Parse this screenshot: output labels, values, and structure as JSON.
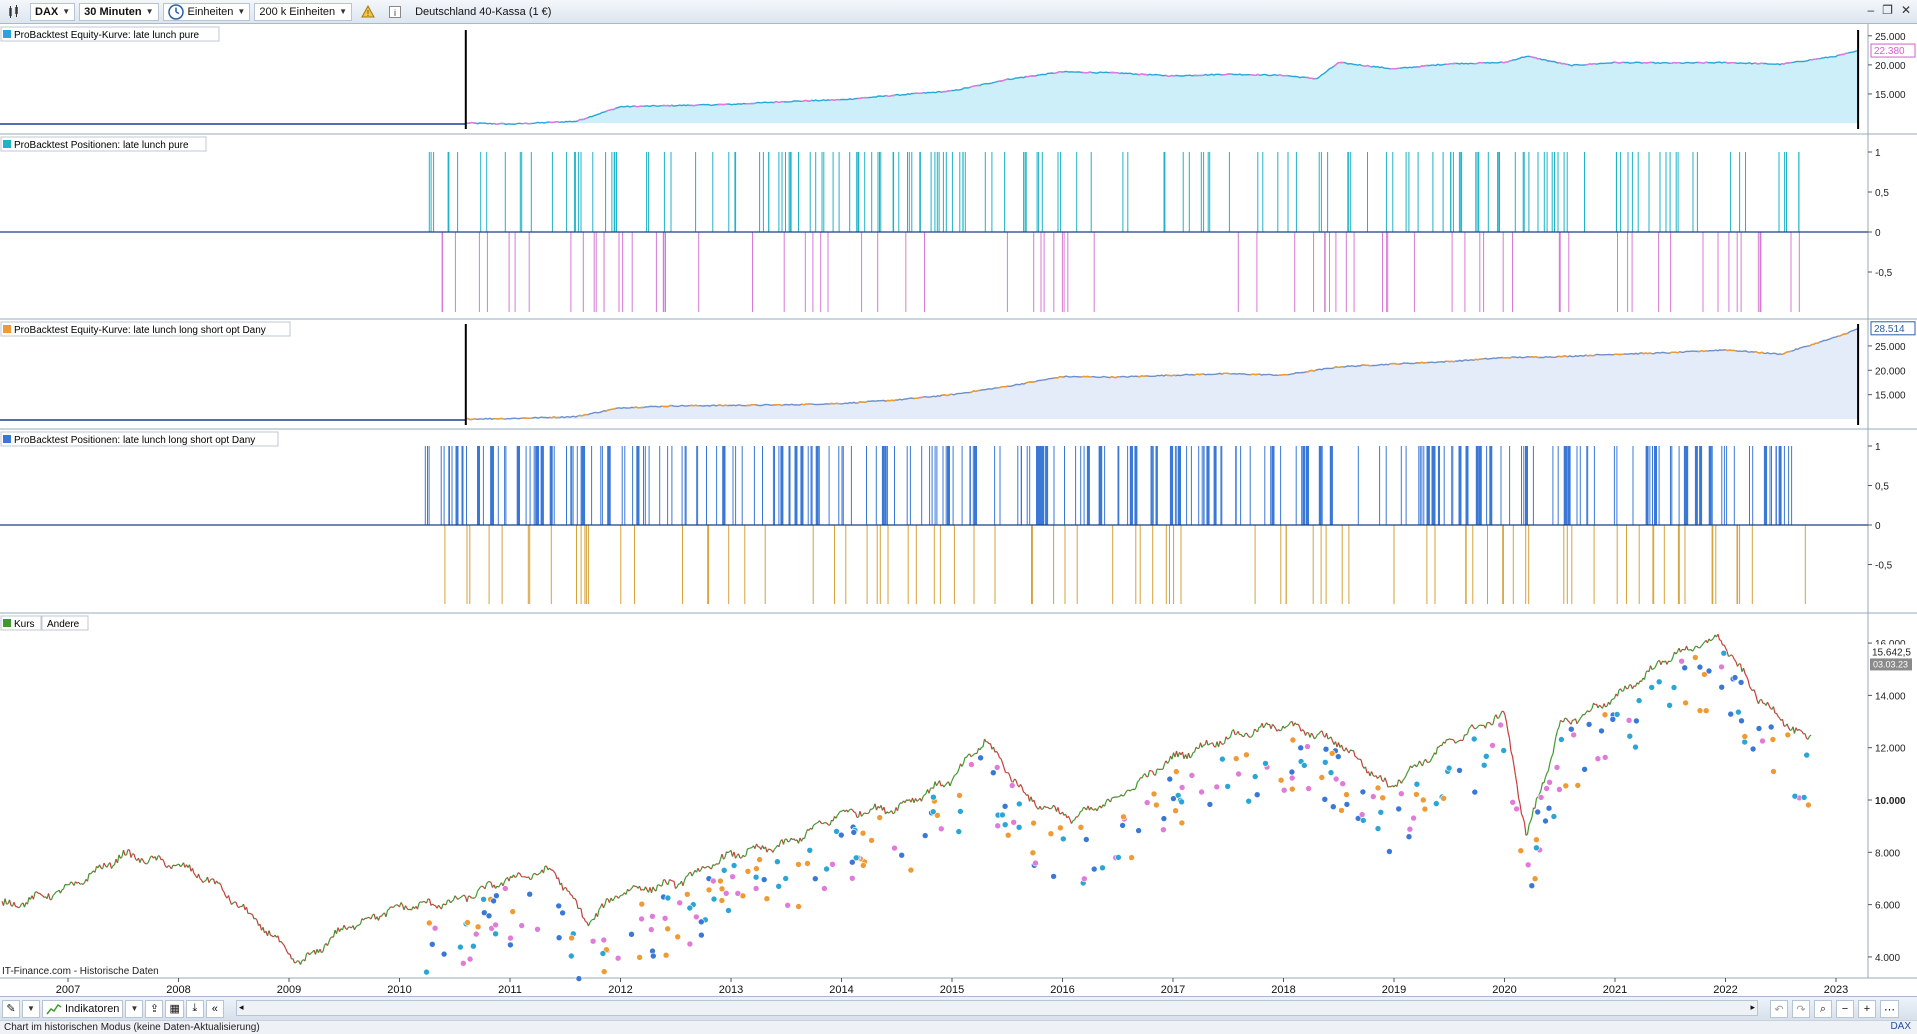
{
  "toolbar": {
    "instrument": "DAX",
    "timeframe": "30 Minuten",
    "units_mode": "Einheiten",
    "units_count": "200 k Einheiten",
    "instrument_name": "Deutschland 40-Kassa (1 €)",
    "warning_icon": "warning-icon",
    "info_icon": "info-icon"
  },
  "panels": {
    "equity1_title": "ProBacktest Equity-Kurve: late lunch pure",
    "positions1_title": "ProBacktest Positionen: late lunch pure",
    "equity2_title": "ProBacktest Equity-Kurve: late lunch long short opt Dany",
    "positions2_title": "ProBacktest Positionen: late lunch long short opt Dany",
    "price_tab1": "Kurs",
    "price_tab2": "Andere",
    "source_text": "IT-Finance.com - Historische Daten"
  },
  "axis_labels": {
    "eq1_ticks": [
      "25.000",
      "20.000",
      "15.000"
    ],
    "eq1_current": "22.380",
    "pos_ticks": [
      "1",
      "0,5",
      "0",
      "-0,5"
    ],
    "eq2_ticks": [
      "25.000",
      "20.000",
      "15.000"
    ],
    "eq2_current": "28.514",
    "price_ticks": [
      "16.000",
      "14.000",
      "12.000",
      "10.000",
      "8.000",
      "6.000",
      "4.000"
    ],
    "price_current": "15.642,5",
    "price_date": "03.03.23",
    "years": [
      "2007",
      "2008",
      "2009",
      "2010",
      "2011",
      "2012",
      "2013",
      "2014",
      "2015",
      "2016",
      "2017",
      "2018",
      "2019",
      "2020",
      "2021",
      "2022",
      "2023"
    ]
  },
  "bottombar": {
    "indicators_label": "Indikatoren"
  },
  "status": {
    "text": "Chart im historischen Modus (keine Daten-Aktualisierung)",
    "right_label": "DAX"
  },
  "colors": {
    "equity1_line": "#2aa6d6",
    "equity1_alt": "#e07bd8",
    "equity1_fill": "#cdeffa",
    "equity2_line": "#6f8fc8",
    "equity2_alt": "#f09a33",
    "equity2_fill": "#e3ecf8",
    "pos1_long": "#1eb3c6",
    "pos1_short": "#d87ad6",
    "pos2_long": "#3a78d8",
    "pos2_short": "#d6a23a",
    "price_up": "#3f9a2e",
    "price_down": "#c93b3b"
  },
  "chart_data": [
    {
      "type": "area",
      "title": "ProBacktest Equity-Kurve: late lunch pure",
      "x": [
        2010.6,
        2011.0,
        2011.6,
        2012.0,
        2012.5,
        2013.0,
        2013.5,
        2014.0,
        2014.5,
        2015.0,
        2015.5,
        2016.0,
        2016.5,
        2017.0,
        2017.5,
        2018.0,
        2018.3,
        2018.5,
        2019.0,
        2019.5,
        2020.0,
        2020.2,
        2020.6,
        2021.0,
        2021.5,
        2022.0,
        2022.5,
        2023.0,
        2023.2
      ],
      "values": [
        10000,
        9800,
        10300,
        12800,
        13000,
        13200,
        13700,
        14000,
        14800,
        15500,
        17500,
        18800,
        18600,
        18100,
        18400,
        18200,
        17600,
        20400,
        19300,
        20200,
        20400,
        21500,
        19900,
        20400,
        20300,
        20400,
        20100,
        21500,
        22380
      ],
      "ylim": [
        10000,
        26000
      ]
    },
    {
      "type": "area",
      "title": "ProBacktest Equity-Kurve: late lunch long short opt Dany",
      "x": [
        2010.6,
        2011.0,
        2011.6,
        2012.0,
        2012.5,
        2013.0,
        2013.5,
        2014.0,
        2014.5,
        2015.0,
        2015.5,
        2016.0,
        2016.5,
        2017.0,
        2017.5,
        2018.0,
        2018.5,
        2019.0,
        2019.5,
        2020.0,
        2020.5,
        2021.0,
        2021.5,
        2022.0,
        2022.5,
        2023.0,
        2023.2
      ],
      "values": [
        10000,
        10100,
        10500,
        12300,
        12700,
        12800,
        12900,
        13200,
        13900,
        15000,
        16700,
        18700,
        18600,
        19000,
        19300,
        19000,
        20700,
        21300,
        21800,
        22600,
        22800,
        23300,
        23600,
        24200,
        23300,
        26800,
        28514
      ],
      "ylim": [
        10000,
        29500
      ]
    },
    {
      "type": "line",
      "title": "Kurs",
      "x": [
        2006.5,
        2007.0,
        2007.5,
        2008.0,
        2008.3,
        2008.8,
        2009.1,
        2009.5,
        2010.0,
        2010.5,
        2011.0,
        2011.4,
        2011.7,
        2012.0,
        2012.5,
        2013.0,
        2013.5,
        2014.0,
        2014.5,
        2015.0,
        2015.3,
        2015.7,
        2016.1,
        2016.5,
        2017.0,
        2017.5,
        2018.0,
        2018.5,
        2018.95,
        2019.5,
        2020.0,
        2020.2,
        2020.5,
        2021.0,
        2021.5,
        2021.95,
        2022.3,
        2022.75,
        2023.0,
        2023.2
      ],
      "values": [
        6000,
        6600,
        7900,
        7500,
        6900,
        5000,
        3700,
        5100,
        5900,
        6100,
        7000,
        7300,
        5300,
        6500,
        6800,
        7900,
        8300,
        9500,
        9700,
        10800,
        12300,
        10000,
        9300,
        10100,
        11600,
        12400,
        12900,
        12200,
        10500,
        12200,
        13300,
        8600,
        12800,
        13900,
        15500,
        16200,
        13900,
        12200,
        14600,
        15642.5
      ],
      "ylim": [
        3500,
        16500
      ]
    }
  ]
}
